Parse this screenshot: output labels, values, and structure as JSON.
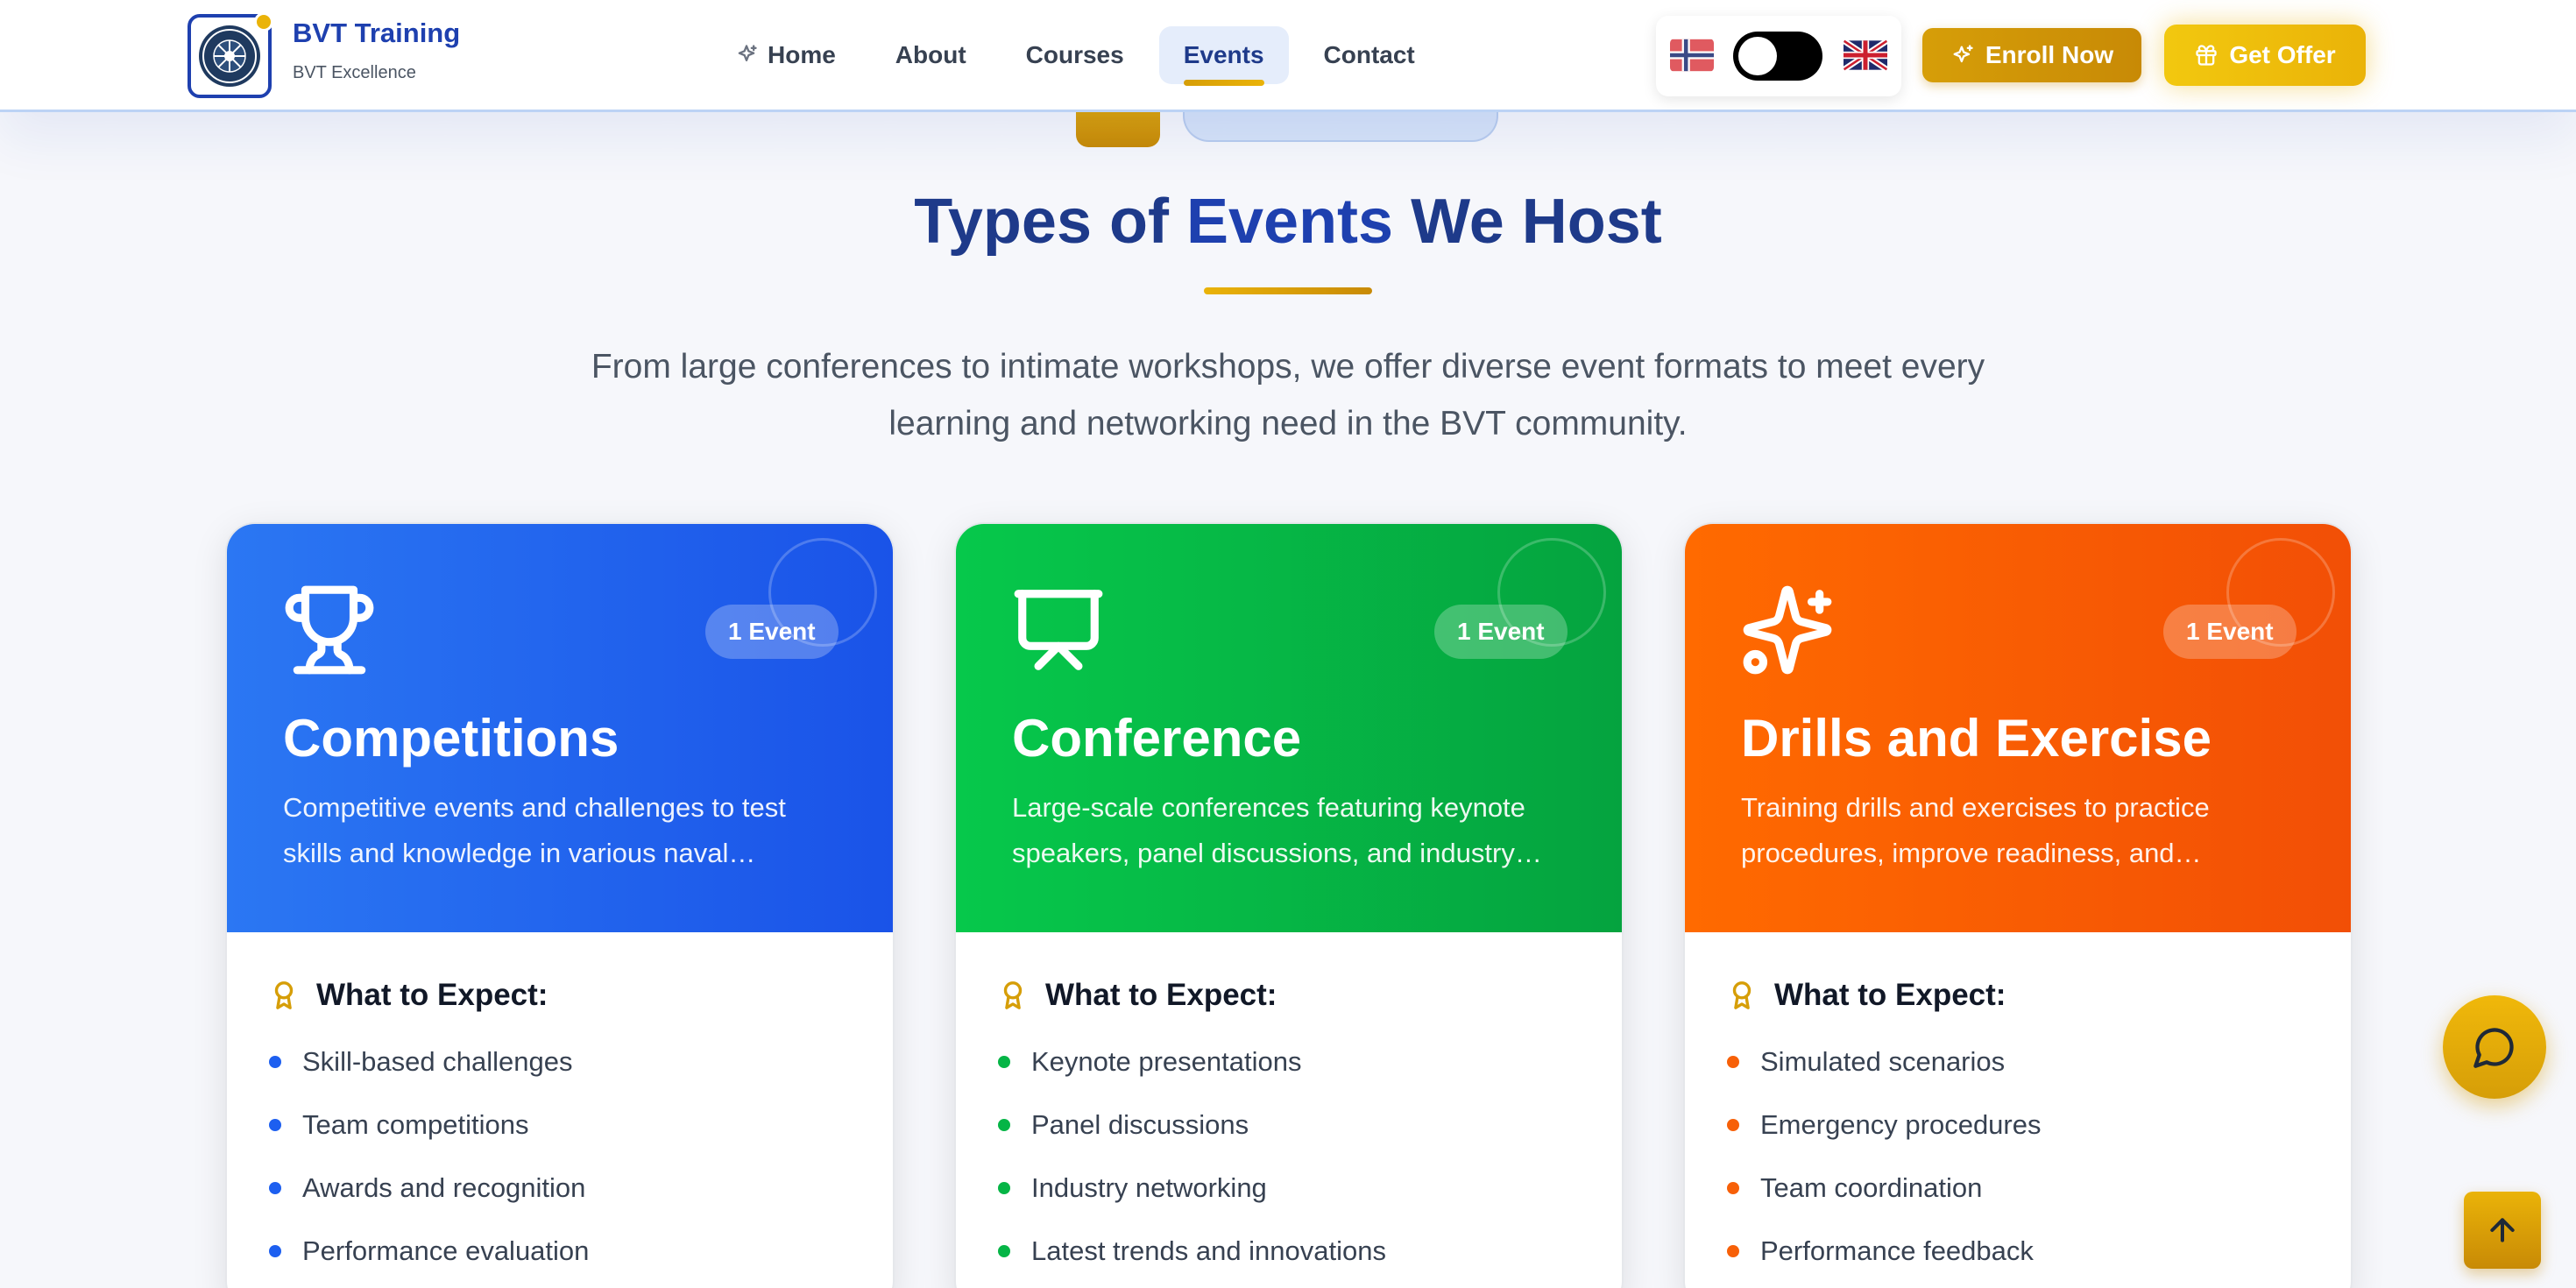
{
  "header": {
    "brand_title": "BVT Training",
    "brand_subtitle": "BVT Excellence",
    "nav": [
      {
        "label": "Home",
        "active": false
      },
      {
        "label": "About",
        "active": false
      },
      {
        "label": "Courses",
        "active": false
      },
      {
        "label": "Events",
        "active": true
      },
      {
        "label": "Contact",
        "active": false
      }
    ],
    "enroll_label": "Enroll Now",
    "offer_label": "Get Offer"
  },
  "section": {
    "title_part1": "Types of ",
    "title_part2": "Events",
    "title_part3": " We Host",
    "description": "From large conferences to intimate workshops, we offer diverse event formats to meet every learning and networking need in the BVT community."
  },
  "cards": [
    {
      "badge": "1 Event",
      "title": "Competitions",
      "description": "Competitive events and challenges to test skills and knowledge in various naval disciplines.",
      "expect_title": "What to Expect:",
      "items": [
        "Skill-based challenges",
        "Team competitions",
        "Awards and recognition",
        "Performance evaluation"
      ],
      "icon": "trophy-icon"
    },
    {
      "badge": "1 Event",
      "title": "Conference",
      "description": "Large-scale conferences featuring keynote speakers, panel discussions, and industry networking.",
      "expect_title": "What to Expect:",
      "items": [
        "Keynote presentations",
        "Panel discussions",
        "Industry networking",
        "Latest trends and innovations"
      ],
      "icon": "presentation-icon"
    },
    {
      "badge": "1 Event",
      "title": "Drills and Exercise",
      "description": "Training drills and exercises to practice procedures, improve readiness, and teamwork.",
      "expect_title": "What to Expect:",
      "items": [
        "Simulated scenarios",
        "Emergency procedures",
        "Team coordination",
        "Performance feedback"
      ],
      "icon": "sparkles-icon"
    }
  ],
  "colors": {
    "primary": "#1e40af",
    "gold": "#eab308",
    "blue_card": "#2b77f3",
    "green_card": "#06c84b",
    "orange_card": "#ff6a00"
  }
}
